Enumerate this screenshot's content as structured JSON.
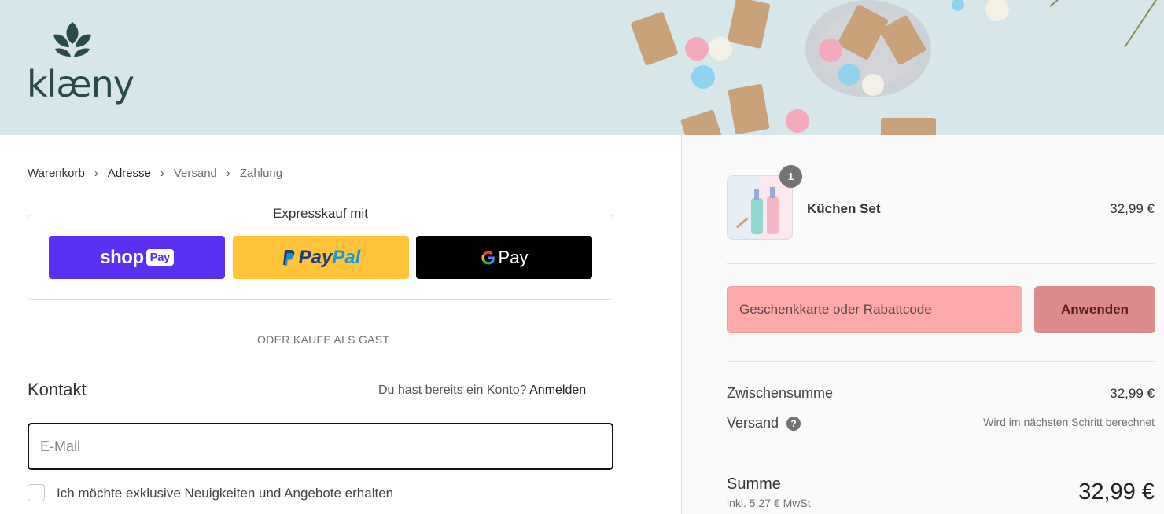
{
  "brand": {
    "name": "klæny",
    "logo_icon": "leaf-icon"
  },
  "breadcrumb": [
    {
      "label": "Warenkorb"
    },
    {
      "label": "Adresse"
    },
    {
      "label": "Versand"
    },
    {
      "label": "Zahlung"
    }
  ],
  "express": {
    "title": "Expresskauf mit",
    "shop_pay": {
      "shop": "shop",
      "pay": "Pay"
    },
    "paypal": {
      "pay": "Pay",
      "pal": "Pal"
    },
    "gpay": {
      "label": "Pay"
    }
  },
  "guest_divider": "ODER KAUFE ALS GAST",
  "contact": {
    "title": "Kontakt",
    "have_account": "Du hast bereits ein Konto?",
    "login": "Anmelden",
    "email_placeholder": "E-Mail",
    "newsletter_label": "Ich möchte exklusive Neuigkeiten und Angebote erhalten"
  },
  "cart": {
    "item": {
      "name": "Küchen Set",
      "price": "32,99 €",
      "quantity": "1"
    },
    "discount_placeholder": "Geschenkkarte oder Rabattcode",
    "apply_label": "Anwenden",
    "subtotal_label": "Zwischensumme",
    "subtotal_value": "32,99 €",
    "shipping_label": "Versand",
    "shipping_help": "?",
    "shipping_note": "Wird im nächsten Schritt berechnet",
    "total_label": "Summe",
    "tax_note": "inkl. 5,27 € MwSt",
    "total_value": "32,99 €"
  },
  "colors": {
    "banner": "#d7e6e8",
    "shop_pay": "#5a31f4",
    "paypal": "#ffc439",
    "gpay": "#000000",
    "discount_field": "#ffaaaa",
    "apply_button": "#dd8a8a"
  }
}
